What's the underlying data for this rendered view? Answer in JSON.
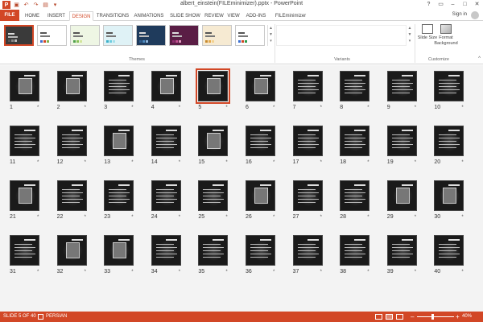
{
  "window": {
    "title": "albert_einstein(FILEminimizer).pptx - PowerPoint"
  },
  "tabs": [
    "FILE",
    "HOME",
    "INSERT",
    "DESIGN",
    "TRANSITIONS",
    "ANIMATIONS",
    "SLIDE SHOW",
    "REVIEW",
    "VIEW",
    "ADD-INS",
    "FILEminimizer"
  ],
  "active_tab": "DESIGN",
  "signin": "Sign in",
  "ribbon": {
    "themes_label": "Themes",
    "variants_label": "Variants",
    "customize_label": "Customize",
    "slide_size_label": "Slide Size",
    "format_background_label": "Format Background",
    "theme_dot_colors": [
      [
        "#555555",
        "#888888",
        "#bbbbbb"
      ],
      [
        "#3f6fd1",
        "#d24726",
        "#7fb24b"
      ],
      [
        "#4fa04b",
        "#88c057",
        "#d2e59a"
      ],
      [
        "#3bb0c9",
        "#6ecde0",
        "#a5e0ea"
      ],
      [
        "#2f5d8f",
        "#4d8ac0",
        "#8fb6dd"
      ],
      [
        "#8f2d6f",
        "#c04d90",
        "#e39ac0"
      ],
      [
        "#c78a2d",
        "#e5a94d",
        "#f3d28f"
      ],
      [
        "#3a6fd1",
        "#d24726",
        "#2a9a4b"
      ]
    ]
  },
  "slides": {
    "count": 40,
    "selected": 5,
    "star": "*"
  },
  "status": {
    "slide_info": "SLIDE 5 OF 40",
    "language": "PERSIAN",
    "zoom": "40%",
    "zoom_level": 0.4
  },
  "colors": {
    "accent": "#d24726"
  }
}
